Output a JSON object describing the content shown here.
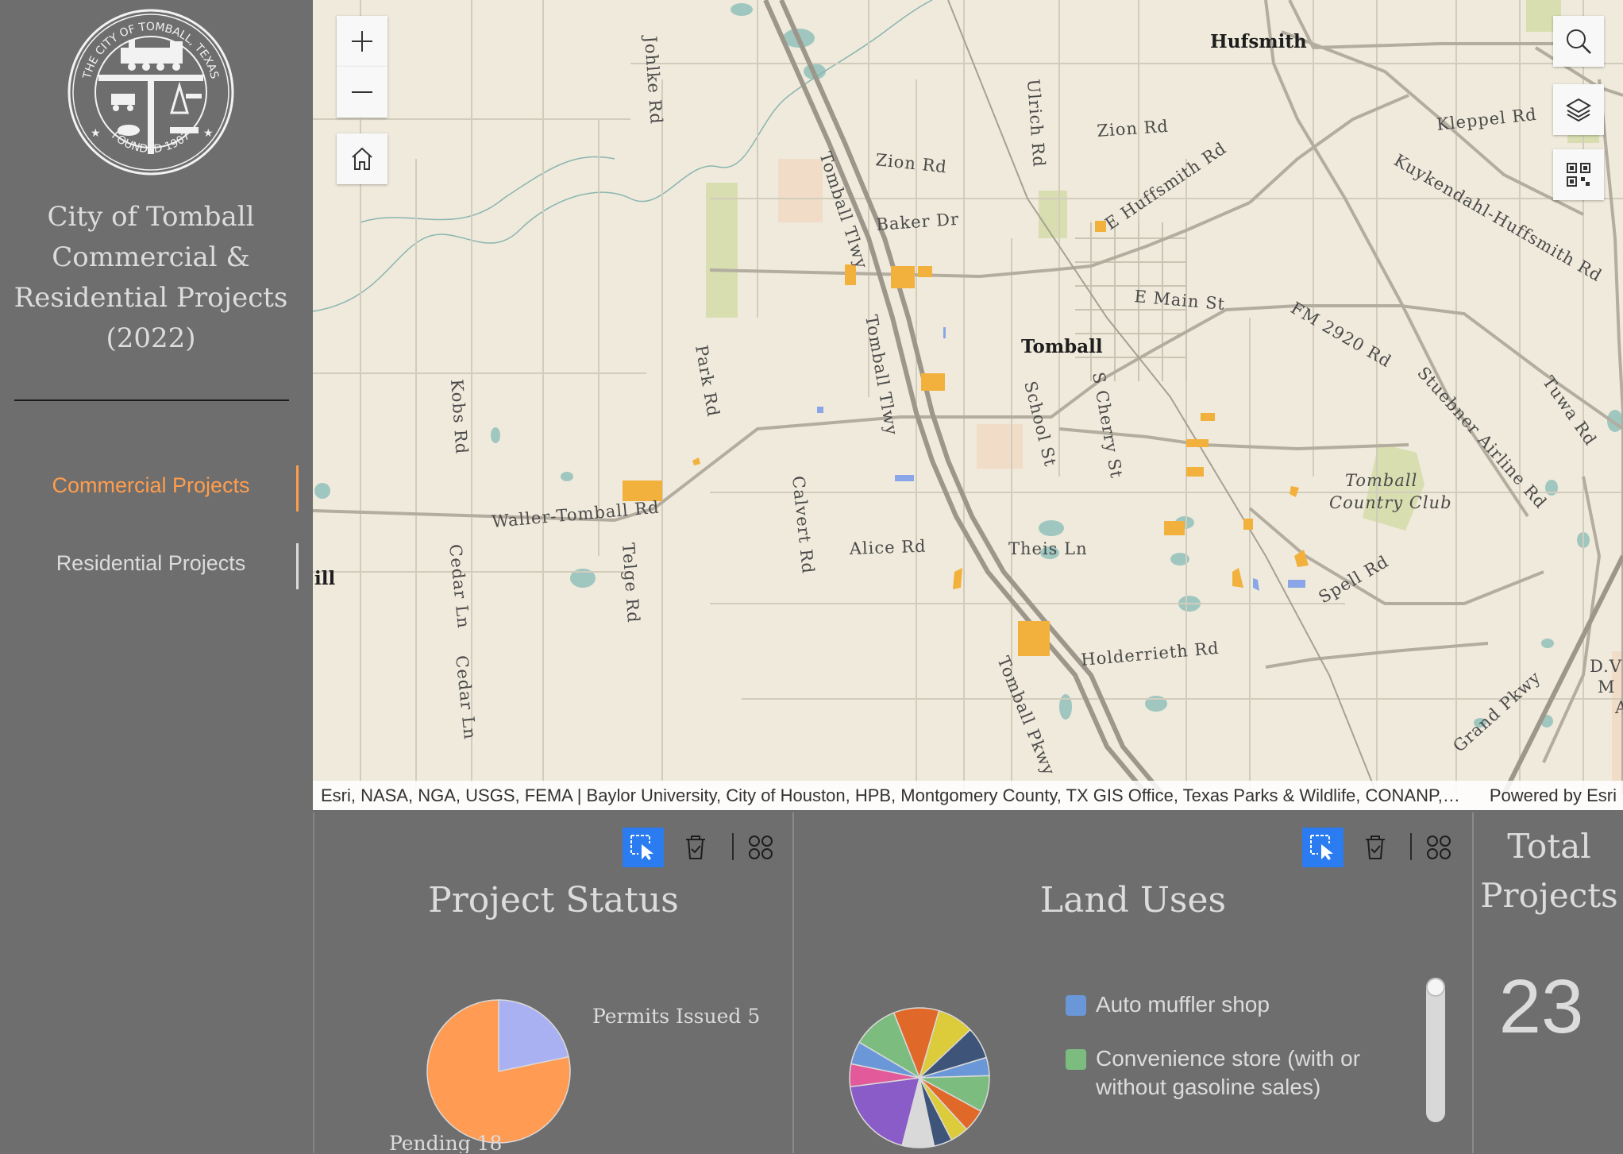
{
  "sidebar": {
    "seal_text_top": "THE CITY OF TOMBALL, TEXAS",
    "seal_text_bottom": "FOUNDED 1907",
    "title_lines": [
      "City of Tomball",
      "Commercial &",
      "Residential Projects",
      "(2022)"
    ],
    "tabs": [
      {
        "label": "Commercial Projects",
        "active": true
      },
      {
        "label": "Residential Projects",
        "active": false
      }
    ]
  },
  "map": {
    "controls": [
      "zoom-in",
      "zoom-out",
      "home",
      "search",
      "layers",
      "qr-code"
    ],
    "labels": {
      "hufsmith": "Hufsmith",
      "tomball": "Tomball",
      "zion_rd_1": "Zion Rd",
      "zion_rd_2": "Zion Rd",
      "baker_dr": "Baker Dr",
      "e_huffsmith": "E Huffsmith Rd",
      "kleppel": "Kleppel Rd",
      "kuykendahl": "Kuykendahl-Huffsmith Rd",
      "e_main": "E Main St",
      "fm2920": "FM 2920 Rd",
      "stuebner": "Stuebner Airline Rd",
      "tuwa": "Tuwa Rd",
      "johlke": "Johlke Rd",
      "ulrich": "Ulrich Rd",
      "tomball_tlwy_1": "Tomball Tlwy",
      "tomball_tlwy_2": "Tomball Tlwy",
      "park_rd": "Park Rd",
      "kobs_rd": "Kobs Rd",
      "school_st": "School St",
      "s_cherry": "S Cherry St",
      "waller_tomball": "Waller-Tomball Rd",
      "calvert": "Calvert Rd",
      "alice": "Alice Rd",
      "theis": "Theis Ln",
      "telge": "Telge Rd",
      "cedar_ln_1": "Cedar Ln",
      "cedar_ln_2": "Cedar Ln",
      "holderrieth": "Holderrieth Rd",
      "spell": "Spell Rd",
      "grand_pkwy": "Grand Pkwy",
      "tomball_pkwy": "Tomball Pkwy",
      "country_club_1": "Tomball",
      "country_club_2": "Country Club",
      "ill": "ill",
      "dv": "D.V",
      "m": "M",
      "a": "A"
    },
    "attribution": "Esri, NASA, NGA, USGS, FEMA | Baylor University, City of Houston, HPB, Montgomery County, TX GIS Office, Texas Parks & Wildlife, CONANP, Esri, TomTom, Garmin, SafeGraph, GeoTechnologies, Inc, METI/NASA, USGS, EPA, NPS, US Census Bureau, USDA, USFWS",
    "powered_by": "Powered by Esri"
  },
  "status_panel": {
    "title": "Project Status",
    "chart_data": {
      "type": "pie",
      "categories": [
        "Permits Issued",
        "Pending"
      ],
      "values": [
        5,
        18
      ],
      "colors": [
        "#a9b1f2",
        "#ff9b52"
      ],
      "labels": [
        "Permits Issued 5",
        "Pending 18"
      ]
    }
  },
  "landuse_panel": {
    "title": "Land Uses",
    "legend": [
      {
        "label": "Auto muffler shop",
        "color": "#6a97d8"
      },
      {
        "label": "Convenience store (with or without gasoline sales)",
        "color": "#7cbd7f"
      }
    ],
    "chart_data": {
      "type": "pie",
      "slices": [
        {
          "color": "#e0692a",
          "value": 10
        },
        {
          "color": "#dccb3a",
          "value": 8
        },
        {
          "color": "#3e5478",
          "value": 7
        },
        {
          "color": "#6a97d8",
          "value": 4
        },
        {
          "color": "#7cbd7f",
          "value": 8
        },
        {
          "color": "#e0692a",
          "value": 5
        },
        {
          "color": "#dccb3a",
          "value": 4
        },
        {
          "color": "#3e5478",
          "value": 4
        },
        {
          "color": "#d9d9d9",
          "value": 7
        },
        {
          "color": "#8a5cc8",
          "value": 18
        },
        {
          "color": "#e25a9a",
          "value": 5
        },
        {
          "color": "#6a97d8",
          "value": 5
        },
        {
          "color": "#7cbd7f",
          "value": 10
        }
      ]
    }
  },
  "total_panel": {
    "title_lines": [
      "Total",
      "Projects"
    ],
    "value": "23"
  }
}
